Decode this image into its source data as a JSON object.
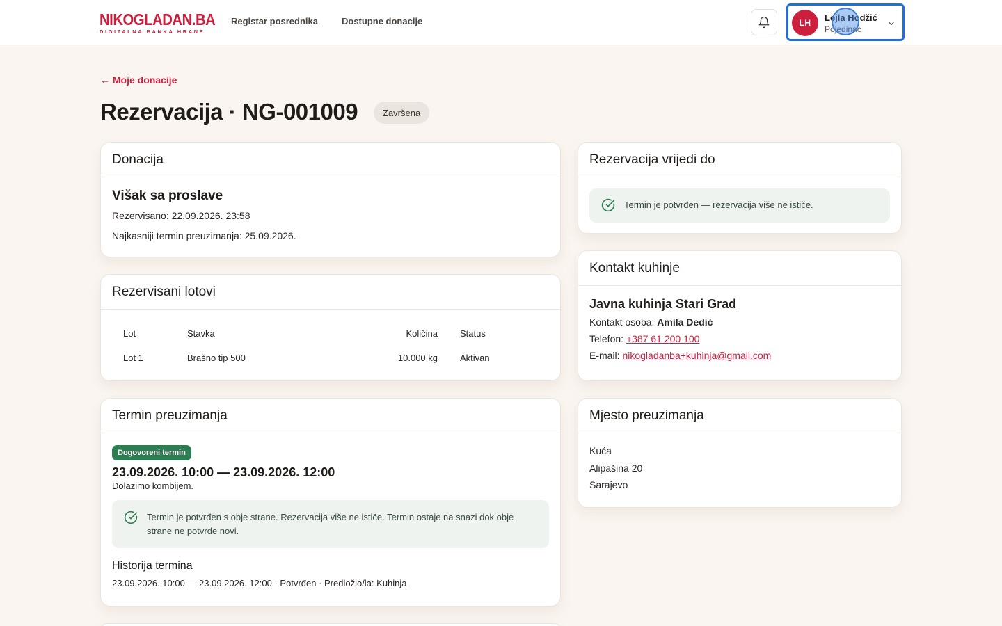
{
  "header": {
    "logo_main_a": "NIKO",
    "logo_main_b": "GLADAN.BA",
    "logo_sub": "DIGITALNA BANKA HRANE",
    "nav": [
      "Registar posrednika",
      "Dostupne donacije"
    ],
    "user": {
      "initials": "LH",
      "name": "Lejla Hodžić",
      "role": "Pojedinac"
    }
  },
  "page": {
    "back_label": "← Moje donacije",
    "title": "Rezervacija · NG-001009",
    "status": "Završena"
  },
  "donation": {
    "heading": "Donacija",
    "title": "Višak sa proslave",
    "reserved": "Rezervisano: 22.09.2026. 23:58",
    "latest_pickup": "Najkasniji termin preuzimanja: 25.09.2026."
  },
  "lots": {
    "heading": "Rezervisani lotovi",
    "columns": [
      "Lot",
      "Stavka",
      "Količina",
      "Status"
    ],
    "rows": [
      [
        "Lot 1",
        "Brašno tip 500",
        "10.000 kg",
        "Aktivan"
      ]
    ]
  },
  "pickup_term": {
    "heading": "Termin preuzimanja",
    "badge": "Dogovoreni termin",
    "range": "23.09.2026. 10:00 — 23.09.2026. 12:00",
    "note": "Dolazimo kombijem.",
    "confirm_text": "Termin je potvrđen s obje strane. Rezervacija više ne ističe. Termin ostaje na snazi dok obje strane ne potvrde novi.",
    "history_heading": "Historija termina",
    "history_item": "23.09.2026. 10:00 — 23.09.2026. 12:00 · Potvrđen · Predložio/la: Kuhinja"
  },
  "valid_until": {
    "heading": "Rezervacija vrijedi do",
    "text": "Termin je potvrđen — rezervacija više ne ističe."
  },
  "kitchen": {
    "heading": "Kontakt kuhinje",
    "name": "Javna kuhinja Stari Grad",
    "contact_label": "Kontakt osoba: ",
    "contact_name": "Amila Dedić",
    "phone_label": "Telefon: ",
    "phone": "+387 61 200 100",
    "email_label": "E-mail: ",
    "email": "nikogladanba+kuhinja@gmail.com"
  },
  "place": {
    "heading": "Mjesto preuzimanja",
    "lines": [
      "Kuća",
      "Alipašina 20",
      "Sarajevo"
    ]
  },
  "colors": {
    "brand": "#cc1f3d",
    "success": "#2c7d52",
    "focus": "#1e6fe0"
  }
}
